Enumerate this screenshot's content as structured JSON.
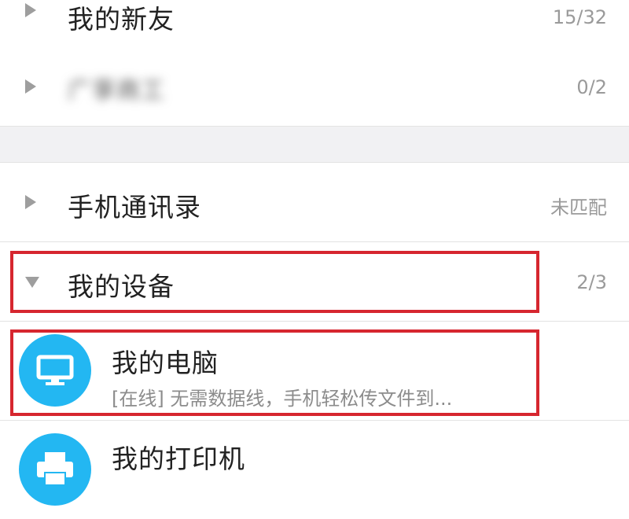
{
  "groups": [
    {
      "name": "我的新友",
      "count": "15/32",
      "expanded": false
    },
    {
      "name": "广享商工",
      "count": "0/2",
      "expanded": false,
      "blurred": true
    },
    {
      "name": "手机通讯录",
      "count": "未匹配",
      "expanded": false
    },
    {
      "name": "我的设备",
      "count": "2/3",
      "expanded": true
    }
  ],
  "devices": [
    {
      "title": "我的电脑",
      "subtitle": "[在线] 无需数据线，手机轻松传文件到...",
      "icon": "monitor-icon"
    },
    {
      "title": "我的打印机",
      "icon": "printer-icon"
    }
  ],
  "colors": {
    "highlight": "#d6262f",
    "avatar": "#23b7f2",
    "arrow": "#9e9e9e"
  }
}
